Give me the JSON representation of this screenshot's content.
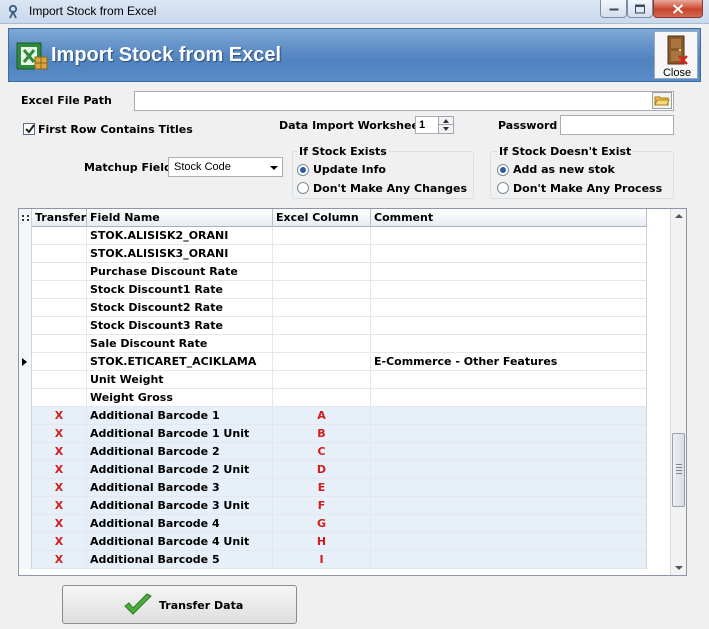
{
  "window": {
    "title": "Import Stock from Excel"
  },
  "header": {
    "title": "Import Stock from Excel",
    "close_label": "Close"
  },
  "form": {
    "excel_file_path_label": "Excel File Path",
    "excel_file_path_value": "",
    "first_row_titles_label": "First Row Contains Titles",
    "first_row_titles_checked": true,
    "worksheet_label": "Data Import Worksheet",
    "worksheet_value": "1",
    "password_label": "Password",
    "password_value": "",
    "matchup_label": "Matchup Field",
    "matchup_value": "Stock Code"
  },
  "if_exists": {
    "title": "If Stock Exists",
    "options": [
      "Update Info",
      "Don't Make Any Changes"
    ],
    "selected": 0
  },
  "if_not_exists": {
    "title": "If Stock Doesn't Exist",
    "options": [
      "Add as new stok",
      "Don't Make Any Process"
    ],
    "selected": 0
  },
  "grid": {
    "columns": [
      "Transfer",
      "Field Name",
      "Excel Column",
      "Comment"
    ],
    "rows": [
      {
        "transfer": "",
        "field": "STOK.ALISISK2_ORANI",
        "column": "",
        "comment": ""
      },
      {
        "transfer": "",
        "field": "STOK.ALISISK3_ORANI",
        "column": "",
        "comment": ""
      },
      {
        "transfer": "",
        "field": "Purchase Discount Rate",
        "column": "",
        "comment": ""
      },
      {
        "transfer": "",
        "field": "Stock Discount1 Rate",
        "column": "",
        "comment": ""
      },
      {
        "transfer": "",
        "field": "Stock Discount2 Rate",
        "column": "",
        "comment": ""
      },
      {
        "transfer": "",
        "field": "Stock Discount3 Rate",
        "column": "",
        "comment": ""
      },
      {
        "transfer": "",
        "field": "Sale Discount Rate",
        "column": "",
        "comment": ""
      },
      {
        "transfer": "",
        "field": "STOK.ETICARET_ACIKLAMA",
        "column": "",
        "comment": "E-Commerce - Other Features"
      },
      {
        "transfer": "",
        "field": "Unit Weight",
        "column": "",
        "comment": ""
      },
      {
        "transfer": "",
        "field": "Weight Gross",
        "column": "",
        "comment": ""
      },
      {
        "transfer": "X",
        "field": "Additional Barcode 1",
        "column": "A",
        "comment": ""
      },
      {
        "transfer": "X",
        "field": "Additional Barcode 1 Unit",
        "column": "B",
        "comment": ""
      },
      {
        "transfer": "X",
        "field": "Additional Barcode 2",
        "column": "C",
        "comment": ""
      },
      {
        "transfer": "X",
        "field": "Additional Barcode 2 Unit",
        "column": "D",
        "comment": ""
      },
      {
        "transfer": "X",
        "field": "Additional Barcode 3",
        "column": "E",
        "comment": ""
      },
      {
        "transfer": "X",
        "field": "Additional Barcode 3 Unit",
        "column": "F",
        "comment": ""
      },
      {
        "transfer": "X",
        "field": "Additional Barcode 4",
        "column": "G",
        "comment": ""
      },
      {
        "transfer": "X",
        "field": "Additional Barcode 4 Unit",
        "column": "H",
        "comment": ""
      },
      {
        "transfer": "X",
        "field": "Additional Barcode 5",
        "column": "I",
        "comment": ""
      }
    ],
    "current_row": 7
  },
  "footer": {
    "transfer_label": "Transfer Data"
  },
  "colors": {
    "header_bg": "#4f82bf",
    "mapped_red": "#d31b1b",
    "selected_row": "#e7f0f8"
  }
}
